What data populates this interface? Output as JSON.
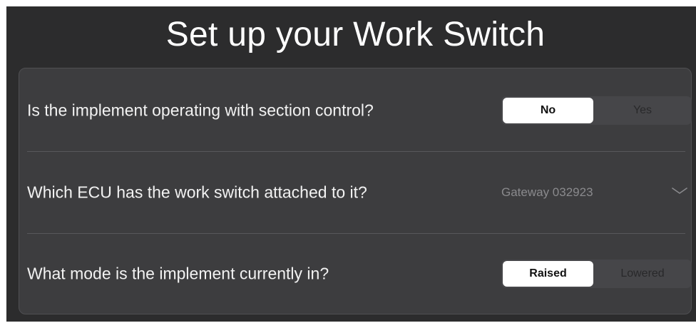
{
  "title": "Set up your Work Switch",
  "questions": [
    {
      "label": "Is the implement operating with section control?",
      "options": [
        "No",
        "Yes"
      ],
      "selected": "No"
    },
    {
      "label": "Which ECU has the work switch attached to it?",
      "value": "Gateway 032923",
      "icon": "chevron-down-icon"
    },
    {
      "label": "What mode is the implement currently in?",
      "options": [
        "Raised",
        "Lowered"
      ],
      "selected": "Raised"
    }
  ],
  "colors": {
    "background": "#2c2c2d",
    "panel": "#3d3d3f",
    "segment_track": "#464649",
    "segment_selected": "#ffffff",
    "dropdown_text": "#8a8a8d"
  }
}
